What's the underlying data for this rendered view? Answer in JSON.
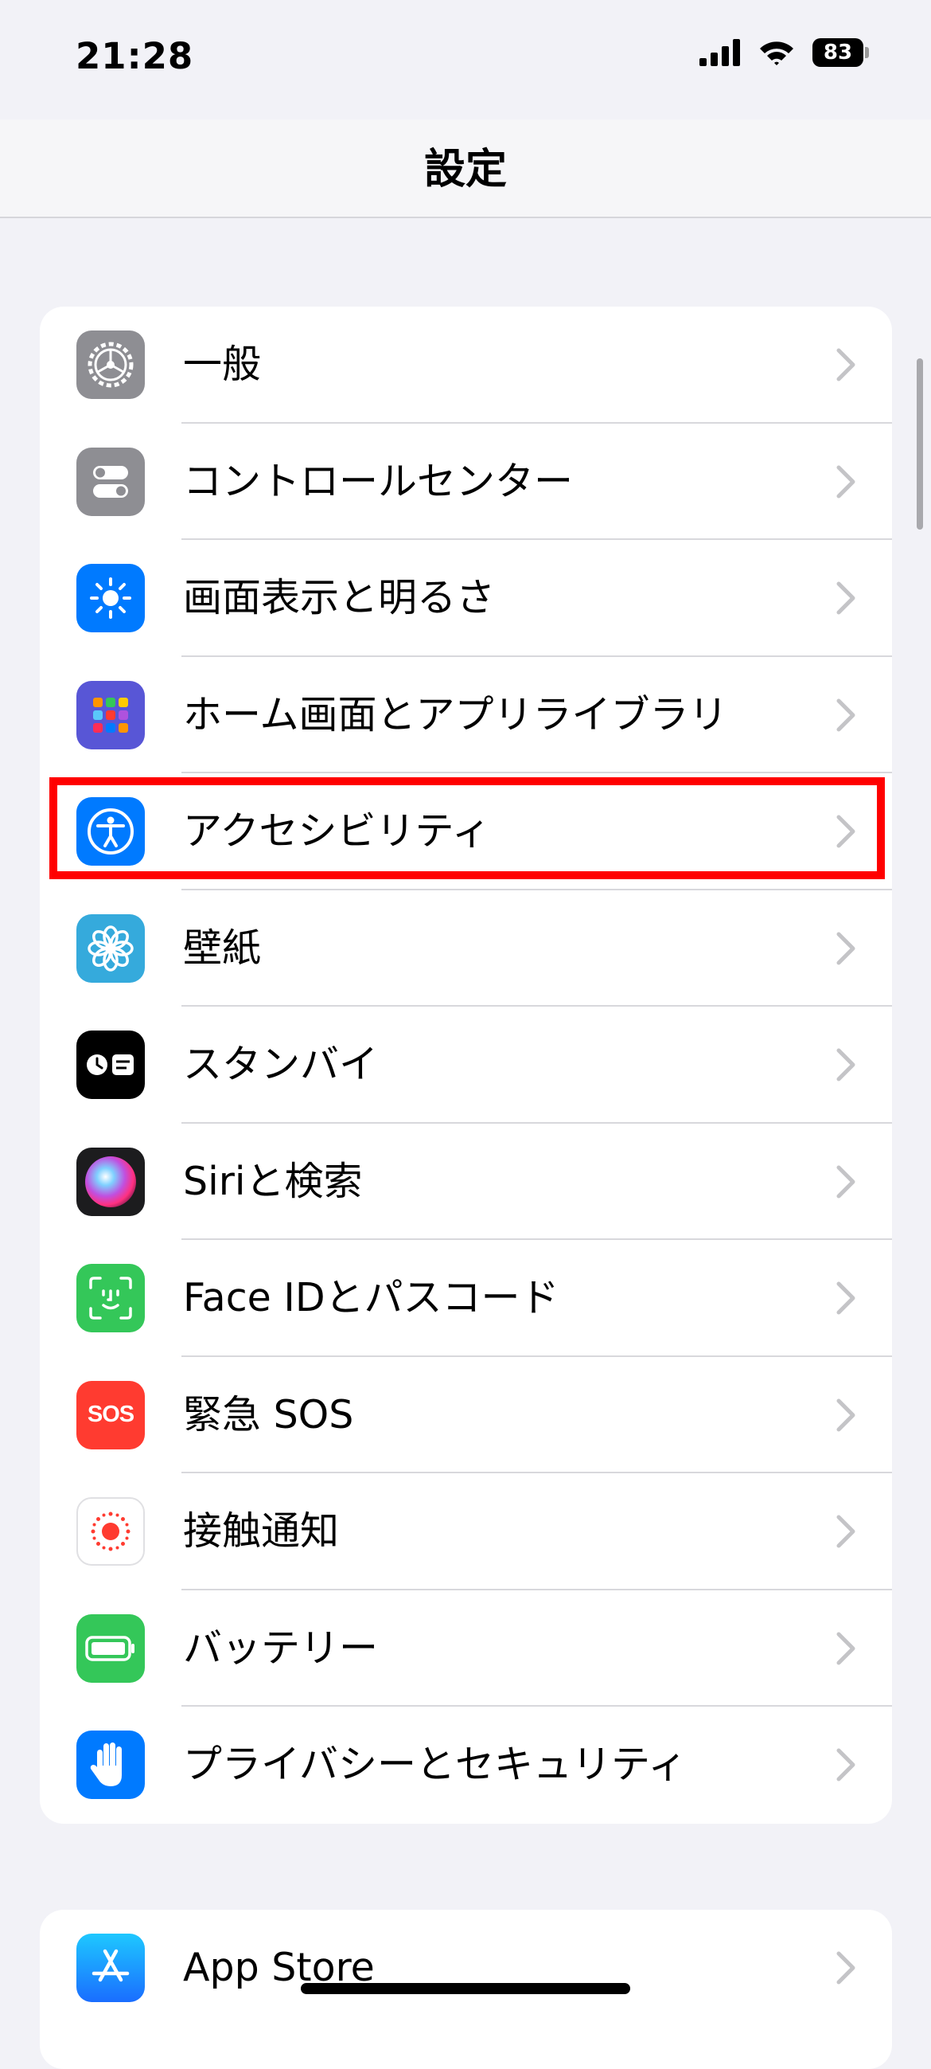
{
  "status_bar": {
    "time": "21:28",
    "battery_level": "83"
  },
  "nav": {
    "title": "設定"
  },
  "settings_items": [
    {
      "label": "一般",
      "icon": "gear-icon",
      "icon_bg": "#8e8e93"
    },
    {
      "label": "コントロールセンター",
      "icon": "toggles-icon",
      "icon_bg": "#8e8e93"
    },
    {
      "label": "画面表示と明るさ",
      "icon": "sun-icon",
      "icon_bg": "#007aff"
    },
    {
      "label": "ホーム画面とアプリライブラリ",
      "icon": "app-grid-icon",
      "icon_bg": "#5856d6"
    },
    {
      "label": "アクセシビリティ",
      "icon": "accessibility-icon",
      "icon_bg": "#007aff",
      "highlighted": true
    },
    {
      "label": "壁紙",
      "icon": "flower-icon",
      "icon_bg": "#35aadc"
    },
    {
      "label": "スタンバイ",
      "icon": "standby-icon",
      "icon_bg": "#000000"
    },
    {
      "label": "Siriと検索",
      "icon": "siri-icon",
      "icon_bg": "#1c1c1e"
    },
    {
      "label": "Face IDとパスコード",
      "icon": "face-id-icon",
      "icon_bg": "#34c759"
    },
    {
      "label": "緊急 SOS",
      "icon": "sos-icon",
      "icon_bg": "#ff3b30",
      "icon_text": "SOS"
    },
    {
      "label": "接触通知",
      "icon": "exposure-icon",
      "icon_bg": "#ffffff"
    },
    {
      "label": "バッテリー",
      "icon": "battery-icon",
      "icon_bg": "#34c759"
    },
    {
      "label": "プライバシーとセキュリティ",
      "icon": "hand-icon",
      "icon_bg": "#007aff"
    }
  ],
  "second_group": [
    {
      "label": "App Store",
      "icon": "app-store-icon",
      "icon_bg": "#1a8cff"
    }
  ],
  "colors": {
    "highlight_border": "#ff0000",
    "background": "#f2f2f7",
    "chevron": "#c4c4c7"
  }
}
